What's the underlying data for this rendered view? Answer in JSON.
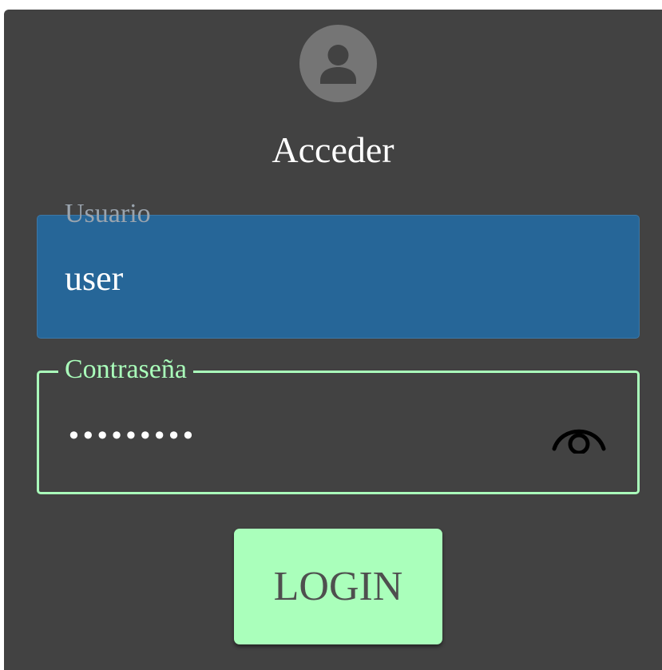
{
  "login_card": {
    "avatar_icon": "account-circle-icon",
    "title": "Acceder",
    "username": {
      "label": "Usuario",
      "value": "user"
    },
    "password": {
      "label": "Contraseña",
      "masked_value": "•••••••••",
      "toggle_icon": "eye-icon"
    },
    "submit_label": "LOGIN"
  },
  "colors": {
    "card_background": "#424242",
    "username_field_fill": "#266698",
    "accent_green": "#aaffbb",
    "avatar_gray": "#757575"
  }
}
